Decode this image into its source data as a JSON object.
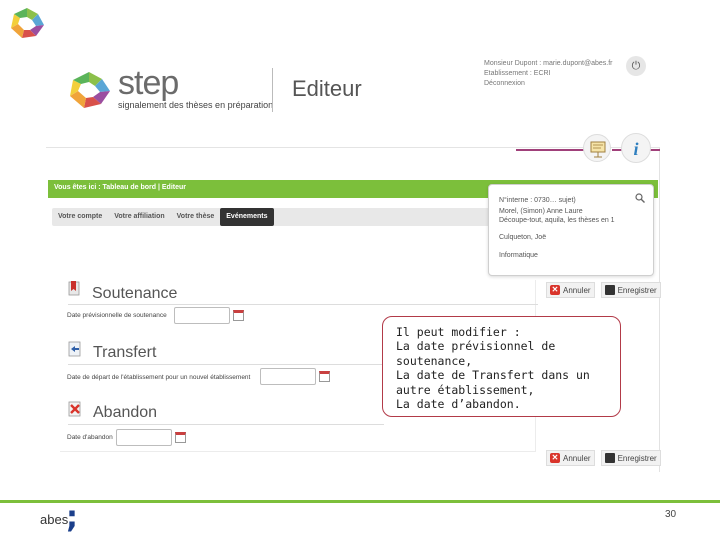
{
  "app": {
    "logo_word": "step",
    "tagline": "signalement des thèses en préparation",
    "module": "Editeur",
    "user_info_lines": [
      "Monsieur Dupont : marie.dupont@abes.fr",
      "Etablissement : ECRI",
      "Déconnexion"
    ]
  },
  "breadcrumb": "Vous êtes ici : Tableau de bord | Editeur",
  "tabs": [
    {
      "label": "Votre compte",
      "active": false
    },
    {
      "label": "Votre affiliation",
      "active": false
    },
    {
      "label": "Votre thèse",
      "active": false
    },
    {
      "label": "Evénements",
      "active": true
    }
  ],
  "thesis_box": {
    "line1": "N°interne : 0730… sujet)",
    "line2": "Morel, (Simon) Anne Laure",
    "line3": "Découpe-tout, aquila, les thèses en 1",
    "line4": "Culqueton, Joë",
    "line5": "Informatique"
  },
  "actions": {
    "cancel_label": "Annuler",
    "save_label": "Enregistrer"
  },
  "sections": {
    "soutenance": {
      "title": "Soutenance",
      "field_label": "Date prévisionnelle de soutenance",
      "value": ""
    },
    "transfert": {
      "title": "Transfert",
      "field_label": "Date de départ de l'établissement pour un nouvel établissement",
      "value": ""
    },
    "abandon": {
      "title": "Abandon",
      "field_label": "Date d'abandon",
      "value": ""
    }
  },
  "callout": {
    "text": "Il peut modifier :\nLa date prévisionnel de soutenance,\nLa date de Transfert dans un autre établissement,\nLa date d’abandon."
  },
  "footer": {
    "org_name": "abes",
    "page_number": "30"
  },
  "colors": {
    "accent_green": "#7cbf3b",
    "accent_purple": "#a0407a",
    "callout_border": "#b23a48",
    "abes_blue": "#1b3f8b"
  }
}
